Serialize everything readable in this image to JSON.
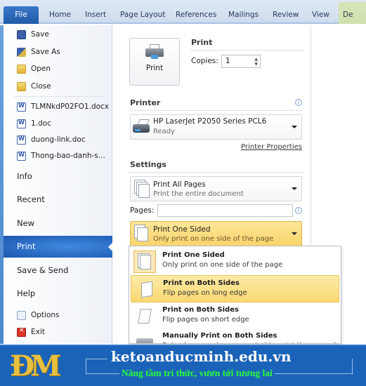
{
  "ribbon": {
    "tabs": [
      {
        "label": "File"
      },
      {
        "label": "Home"
      },
      {
        "label": "Insert"
      },
      {
        "label": "Page Layout"
      },
      {
        "label": "References"
      },
      {
        "label": "Mailings"
      },
      {
        "label": "Review"
      },
      {
        "label": "View"
      },
      {
        "label": "De"
      }
    ]
  },
  "sidebar": {
    "commands": [
      {
        "label": "Save",
        "icon": "save-icon"
      },
      {
        "label": "Save As",
        "icon": "save-as-icon"
      },
      {
        "label": "Open",
        "icon": "open-folder-icon"
      },
      {
        "label": "Close",
        "icon": "close-folder-icon"
      }
    ],
    "recent_files": [
      {
        "label": "TLMNkdP02FO1.docx"
      },
      {
        "label": "1.doc"
      },
      {
        "label": "duong-link.doc"
      },
      {
        "label": "Thong-bao-danh-s..."
      }
    ],
    "nav": [
      {
        "label": "Info"
      },
      {
        "label": "Recent"
      },
      {
        "label": "New"
      },
      {
        "label": "Print",
        "active": true
      },
      {
        "label": "Save & Send"
      },
      {
        "label": "Help"
      }
    ],
    "bottom": [
      {
        "label": "Options"
      },
      {
        "label": "Exit"
      }
    ]
  },
  "print": {
    "button_label": "Print",
    "heading": "Print",
    "copies_label": "Copies:",
    "copies_value": "1"
  },
  "printer": {
    "heading": "Printer",
    "name": "HP LaserJet P2050 Series PCL6",
    "status": "Ready",
    "properties_link": "Printer Properties"
  },
  "settings": {
    "heading": "Settings",
    "range": {
      "title": "Print All Pages",
      "desc": "Print the entire document"
    },
    "pages_label": "Pages:",
    "pages_value": "",
    "sides": {
      "title": "Print One Sided",
      "desc": "Only print on one side of the page"
    }
  },
  "sides_menu": [
    {
      "title": "Print One Sided",
      "desc": "Only print on one side of the page",
      "selected": true
    },
    {
      "title": "Print on Both Sides",
      "desc": "Flip pages on long edge",
      "hover": true
    },
    {
      "title": "Print on Both Sides",
      "desc": "Flip pages on short edge"
    },
    {
      "title": "Manually Print on Both Sides",
      "desc": "Reload paper when prompted to print the second side"
    }
  ],
  "banner": {
    "logo": "ĐM",
    "site": "ketoanducminh.edu.vn",
    "slogan": "Nâng tầm tri thức, vươn tới tương lai"
  },
  "colors": {
    "accent": "#1f5aa8",
    "highlight": "#f9d870",
    "banner": "#1a63b8",
    "slogan": "#2bff3a",
    "logo": "#e8c040"
  }
}
